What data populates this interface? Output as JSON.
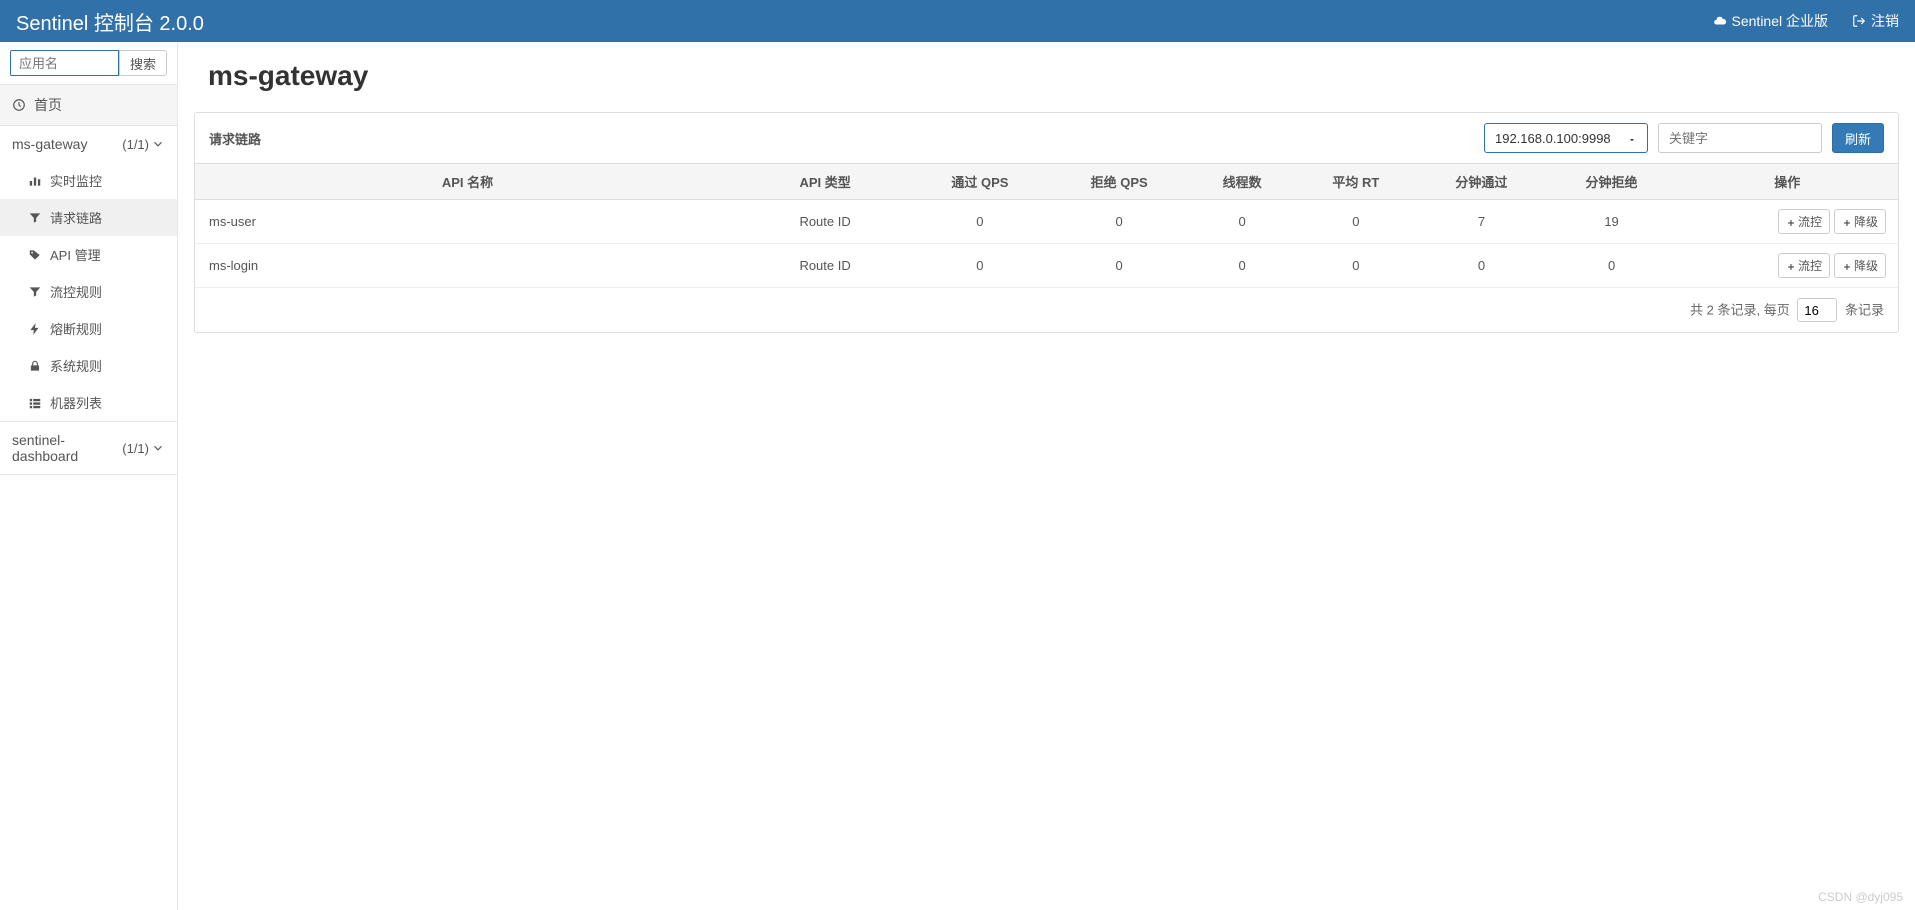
{
  "header": {
    "brand": "Sentinel 控制台 2.0.0",
    "enterprise": "Sentinel 企业版",
    "logout": "注销"
  },
  "sidebar": {
    "search_placeholder": "应用名",
    "search_btn": "搜索",
    "home": "首页",
    "apps": [
      {
        "name": "ms-gateway",
        "count": "(1/1)",
        "expanded": true,
        "items": [
          {
            "label": "实时监控",
            "icon": "chart-bar-icon"
          },
          {
            "label": "请求链路",
            "icon": "filter-icon",
            "active": true
          },
          {
            "label": "API 管理",
            "icon": "tag-icon"
          },
          {
            "label": "流控规则",
            "icon": "filter-icon"
          },
          {
            "label": "熔断规则",
            "icon": "bolt-icon"
          },
          {
            "label": "系统规则",
            "icon": "lock-icon"
          },
          {
            "label": "机器列表",
            "icon": "list-icon"
          }
        ]
      },
      {
        "name": "sentinel-dashboard",
        "count": "(1/1)",
        "expanded": false
      }
    ]
  },
  "page": {
    "title": "ms-gateway",
    "card_title": "请求链路",
    "machine_selected": "192.168.0.100:9998",
    "keyword_placeholder": "关键字",
    "refresh": "刷新",
    "columns": [
      "API 名称",
      "API 类型",
      "通过 QPS",
      "拒绝 QPS",
      "线程数",
      "平均 RT",
      "分钟通过",
      "分钟拒绝",
      "操作"
    ],
    "rows": [
      {
        "name": "ms-user",
        "type": "Route ID",
        "pass_qps": "0",
        "reject_qps": "0",
        "threads": "0",
        "rt": "0",
        "min_pass": "7",
        "min_reject": "19"
      },
      {
        "name": "ms-login",
        "type": "Route ID",
        "pass_qps": "0",
        "reject_qps": "0",
        "threads": "0",
        "rt": "0",
        "min_pass": "0",
        "min_reject": "0"
      }
    ],
    "actions": {
      "flow": "流控",
      "degrade": "降级"
    },
    "footer": {
      "prefix": "共 2 条记录, 每页",
      "page_size": "16",
      "suffix": "条记录"
    }
  },
  "watermark": "CSDN @dyj095"
}
